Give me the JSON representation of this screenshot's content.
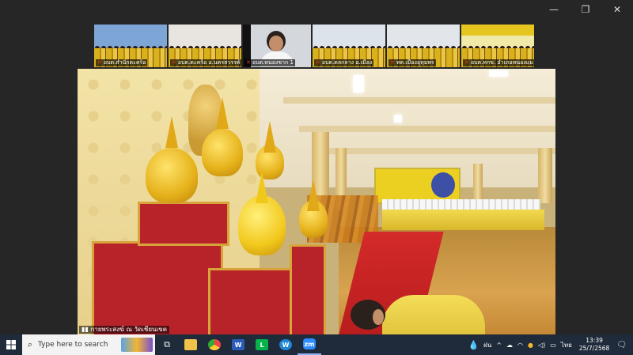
{
  "window": {
    "minimize": "—",
    "restore": "❐",
    "close": "✕"
  },
  "thumbnails": [
    {
      "label": "อบต.สำนักตะคร้อ"
    },
    {
      "label": "อบต.ตะคร้อ อ.นครสวรรค์"
    },
    {
      "label": "อบต.หนองชาก 1"
    },
    {
      "label": "อบต.ตลกลาง อ.เมือง"
    },
    {
      "label": "ทต.เมืองอุทุมพร"
    },
    {
      "label": "อบต.ทกข. อำเภอหนองแม"
    }
  ],
  "main_video": {
    "label": "กายพระสงฆ์ ณ วัดเชียนเขต"
  },
  "taskbar": {
    "search_placeholder": "Type here to search",
    "apps": [
      {
        "name": "task-view-icon",
        "glyph": "⧉"
      },
      {
        "name": "file-explorer-icon",
        "glyph": ""
      },
      {
        "name": "chrome-icon",
        "glyph": ""
      },
      {
        "name": "word-icon",
        "glyph": "W"
      },
      {
        "name": "line-icon",
        "glyph": "L"
      },
      {
        "name": "teams-icon",
        "glyph": "W"
      },
      {
        "name": "zoom-icon",
        "glyph": "zm"
      }
    ],
    "tray": {
      "weather_text": "ฝน",
      "caret": "^",
      "language": "ไทย",
      "time": "13:39",
      "date": "25/7/2568"
    }
  },
  "colors": {
    "accent": "#ecd021",
    "taskbar": "#1f2a3a",
    "background": "#262626",
    "mic_muted": "#e33333"
  }
}
